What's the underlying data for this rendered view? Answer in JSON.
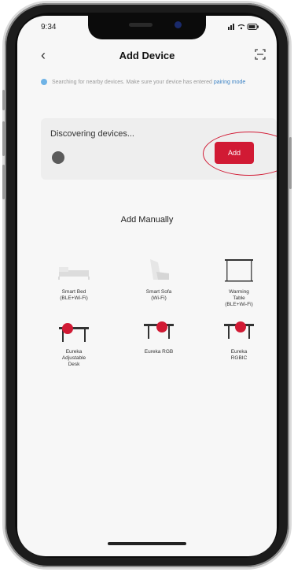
{
  "status": {
    "time": "9:34",
    "right_icons": "signal wifi battery"
  },
  "header": {
    "back": "‹",
    "title": "Add Device",
    "scan_icon": "scan-icon"
  },
  "hint": {
    "text": "Searching for nearby devices. Make sure your device has entered ",
    "link": "pairing mode"
  },
  "discover": {
    "label": "Discovering devices...",
    "add_label": "Add"
  },
  "manual": {
    "title": "Add Manually"
  },
  "devices": [
    {
      "name": "Smart Bed",
      "sub": "(BLE+Wi-Fi)"
    },
    {
      "name": "Smart Sofa",
      "sub": "(Wi-Fi)"
    },
    {
      "name": "Warming",
      "sub": "Table",
      "sub2": "(BLE+Wi-Fi)"
    },
    {
      "name": "Eureka",
      "sub": "Adjustable",
      "sub2": "Desk"
    },
    {
      "name": "Eureka RGB",
      "sub": ""
    },
    {
      "name": "Eureka",
      "sub": "RGBIC"
    }
  ],
  "colors": {
    "accent": "#d11a34"
  }
}
